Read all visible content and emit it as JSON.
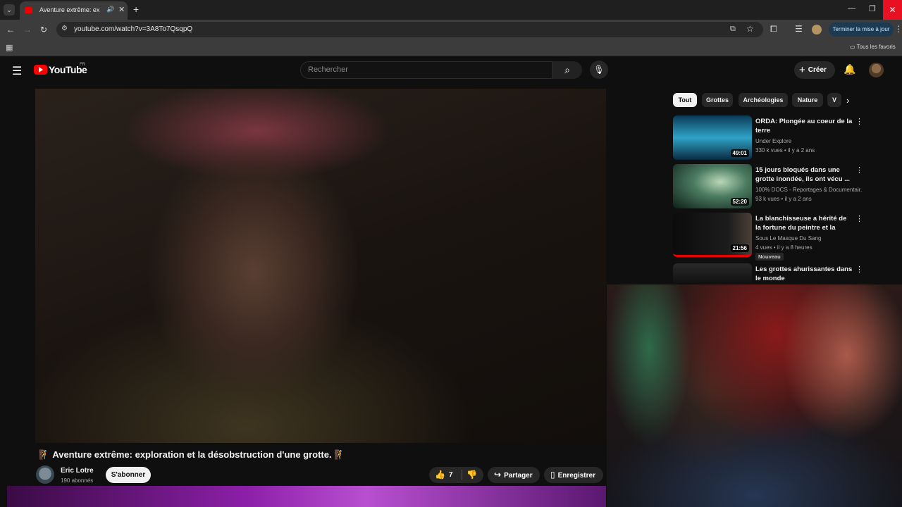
{
  "browser": {
    "tab_title": "Aventure extrême: explo",
    "url": "youtube.com/watch?v=3A8To7QsqpQ",
    "update_button": "Terminer la mise à jour",
    "bookmarks_folder": "Tous les favoris"
  },
  "header": {
    "logo_text": "YouTube",
    "region": "FR",
    "search_placeholder": "Rechercher",
    "create_label": "Créer"
  },
  "video": {
    "title": "🧗 Aventure extrême: exploration et la désobstruction d'une grotte. 🧗",
    "channel": "Eric Lotre",
    "subscribers": "190 abonnés",
    "subscribe_label": "S'abonner",
    "likes": "7",
    "share_label": "Partager",
    "save_label": "Enregistrer"
  },
  "chips": [
    "Tout",
    "Grottes",
    "Archéologies",
    "Nature",
    "V"
  ],
  "recommendations": [
    {
      "title": "ORDA: Plongée au coeur de la terre",
      "channel": "Under Explore",
      "meta": "330 k vues • il y a 2 ans",
      "duration": "49:01"
    },
    {
      "title": "15 jours bloqués dans une grotte inondée, ils ont vécu ...",
      "channel": "100% DOCS - Reportages & Documentair...",
      "meta": "93 k vues • il y a 2 ans",
      "duration": "52:20"
    },
    {
      "title": "La blanchisseuse a hérité de la fortune du peintre et la famille...",
      "channel": "Sous Le Masque Du Sang",
      "meta": "4 vues • il y a 8 heures",
      "duration": "21:56",
      "badge": "Nouveau"
    },
    {
      "title": "Les grottes ahurissantes dans le monde",
      "channel": "",
      "meta": "",
      "duration": ""
    }
  ],
  "colors": {
    "accent": "#ff0000",
    "background": "#0f0f0f",
    "chip": "#272727"
  }
}
